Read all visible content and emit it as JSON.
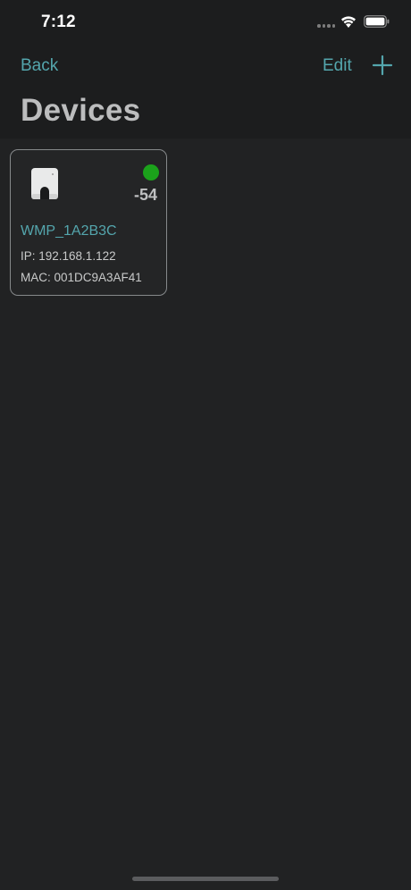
{
  "status_bar": {
    "time": "7:12",
    "icons": [
      "signal-dots-icon",
      "wifi-icon",
      "battery-icon"
    ]
  },
  "nav": {
    "back_label": "Back",
    "edit_label": "Edit",
    "add_icon": "plus-icon"
  },
  "page": {
    "title": "Devices"
  },
  "devices": [
    {
      "name": "WMP_1A2B3C",
      "ip": "IP: 192.168.1.122",
      "mac": "MAC: 001DC9A3AF41",
      "rssi": "-54",
      "status": "online",
      "status_color": "#1ba21b",
      "icon": "device-icon"
    }
  ],
  "colors": {
    "accent": "#54a6ad",
    "background": "#212223",
    "header_background": "#1c1d1e",
    "online": "#1ba21b"
  }
}
